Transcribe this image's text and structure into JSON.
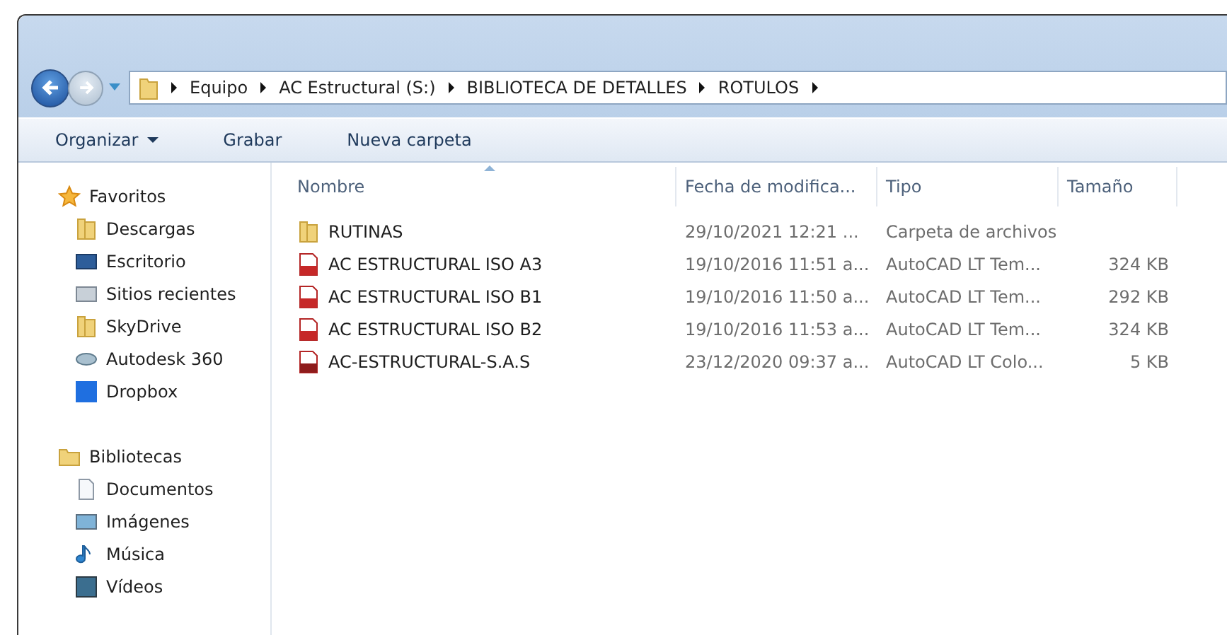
{
  "breadcrumb": [
    "Equipo",
    "AC Estructural (S:)",
    "BIBLIOTECA DE DETALLES",
    "ROTULOS"
  ],
  "toolbar": [
    {
      "label": "Organizar",
      "dropdown": true
    },
    {
      "label": "Grabar",
      "dropdown": false
    },
    {
      "label": "Nueva carpeta",
      "dropdown": false
    }
  ],
  "sidebar": {
    "groups": [
      {
        "label": "Favoritos",
        "kind": "star",
        "children": [
          {
            "label": "Descargas",
            "kind": "downloads"
          },
          {
            "label": "Escritorio",
            "kind": "desktop"
          },
          {
            "label": "Sitios recientes",
            "kind": "recent"
          },
          {
            "label": "SkyDrive",
            "kind": "folder"
          },
          {
            "label": "Autodesk 360",
            "kind": "cloud"
          },
          {
            "label": "Dropbox",
            "kind": "dropbox"
          }
        ]
      },
      {
        "label": "Bibliotecas",
        "kind": "library",
        "children": [
          {
            "label": "Documentos",
            "kind": "document"
          },
          {
            "label": "Imágenes",
            "kind": "image"
          },
          {
            "label": "Música",
            "kind": "music"
          },
          {
            "label": "Vídeos",
            "kind": "video"
          }
        ]
      }
    ]
  },
  "table": {
    "columns": [
      "Nombre",
      "Fecha de modifica...",
      "Tipo",
      "Tamaño"
    ],
    "rows": [
      {
        "kind": "folder",
        "name": "RUTINAS",
        "date": "29/10/2021 12:21 ...",
        "type": "Carpeta de archivos"
      },
      {
        "kind": "dwt",
        "name": "AC ESTRUCTURAL ISO A3",
        "date": "19/10/2016 11:51 a...",
        "type": "AutoCAD LT Tem...",
        "size": "324 KB"
      },
      {
        "kind": "dwt",
        "name": "AC ESTRUCTURAL ISO B1",
        "date": "19/10/2016 11:50 a...",
        "type": "AutoCAD LT Tem...",
        "size": "292 KB"
      },
      {
        "kind": "dwt",
        "name": "AC ESTRUCTURAL ISO B2",
        "date": "19/10/2016 11:53 a...",
        "type": "AutoCAD LT Tem...",
        "size": "324 KB"
      },
      {
        "kind": "ctb",
        "name": "AC-ESTRUCTURAL-S.A.S",
        "date": "23/12/2020 09:37 a...",
        "type": "AutoCAD LT Colo...",
        "size": "5 KB"
      }
    ]
  }
}
